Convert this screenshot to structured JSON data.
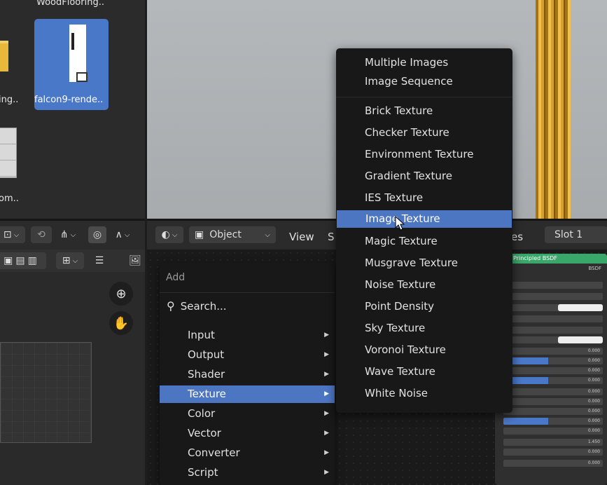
{
  "file_browser": {
    "files": [
      {
        "label": "WoodFlooring..",
        "selected": false
      },
      {
        "label": "falcon9-rende..",
        "selected": true
      },
      {
        "label": "ing..",
        "selected": false
      },
      {
        "label": "om..",
        "selected": false
      }
    ]
  },
  "node_header": {
    "shading_icon": "sphere-icon",
    "object_mode": "Object",
    "view_menu": "View",
    "select_menu_partial": "S",
    "slot_partial": "es",
    "slot": "Slot 1"
  },
  "add_menu": {
    "title": "Add",
    "search_label": "Search...",
    "items": [
      {
        "label": "Input",
        "has_submenu": true
      },
      {
        "label": "Output",
        "has_submenu": true
      },
      {
        "label": "Shader",
        "has_submenu": true
      },
      {
        "label": "Texture",
        "has_submenu": true,
        "highlighted": true
      },
      {
        "label": "Color",
        "has_submenu": true
      },
      {
        "label": "Vector",
        "has_submenu": true
      },
      {
        "label": "Converter",
        "has_submenu": true
      },
      {
        "label": "Script",
        "has_submenu": true
      }
    ]
  },
  "texture_menu": {
    "top_items": [
      "Multiple Images",
      "Image Sequence"
    ],
    "items": [
      "Brick Texture",
      "Checker Texture",
      "Environment Texture",
      "Gradient Texture",
      "IES Texture",
      "Image Texture",
      "Magic Texture",
      "Musgrave Texture",
      "Noise Texture",
      "Point Density",
      "Sky Texture",
      "Voronoi Texture",
      "Wave Texture",
      "White Noise"
    ],
    "highlighted": "Image Texture"
  },
  "bsdf_node": {
    "title": "Principled BSDF",
    "subtitle": "BSDF",
    "values": [
      "0.000",
      "0.000",
      "0.000",
      "0.000",
      "0.000",
      "0.000",
      "0.000",
      "0.000",
      "0.000",
      "1.450",
      "0.000",
      "0.000"
    ]
  },
  "colors": {
    "accent": "#4d76c2",
    "menu_bg": "#181818",
    "node_header_green": "#3aa76a"
  }
}
